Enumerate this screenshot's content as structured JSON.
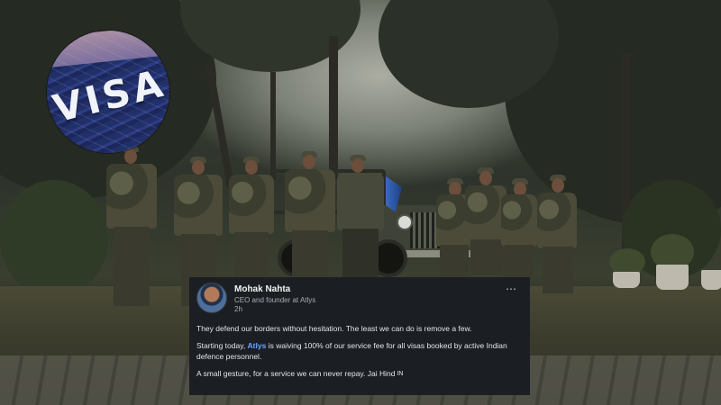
{
  "visa_badge": {
    "text": "VISA"
  },
  "post": {
    "author": "Mohak Nahta",
    "tagline": "CEO and founder at Atlys",
    "time": "2h",
    "more_icon": "⋯",
    "paragraph1": "They defend our borders without hesitation. The least we can do is remove a few.",
    "paragraph2_before": "Starting today, ",
    "paragraph2_link": "Atlys",
    "paragraph2_after": " is waiving 100% of our service fee for all visas booked by active Indian defence personnel.",
    "paragraph3": "A small gesture, for a service we can never repay. Jai Hind",
    "flag_emoji_text": "IN"
  },
  "colors": {
    "post_bg": "#1b1f23",
    "link": "#6aa7ff",
    "visa_blue": "#22306a"
  }
}
